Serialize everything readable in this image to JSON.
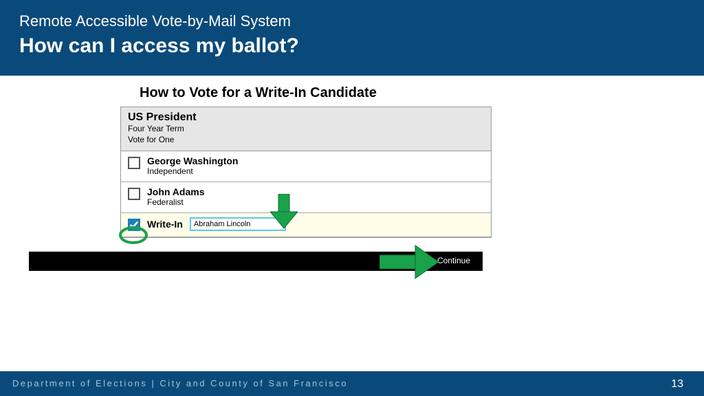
{
  "header": {
    "subtitle": "Remote Accessible Vote-by-Mail System",
    "title": "How can I access my ballot?"
  },
  "section_heading": "How to Vote for a Write-In Candidate",
  "contest": {
    "title": "US President",
    "term": "Four Year Term",
    "rule": "Vote for One",
    "candidates": [
      {
        "name": "George Washington",
        "party": "Independent"
      },
      {
        "name": "John Adams",
        "party": "Federalist"
      }
    ],
    "writein": {
      "label": "Write-In",
      "value": "Abraham Lincoln"
    }
  },
  "continue_label": "Continue",
  "footer_text": "Department of Elections | City and County of San Francisco",
  "page_number": "13"
}
